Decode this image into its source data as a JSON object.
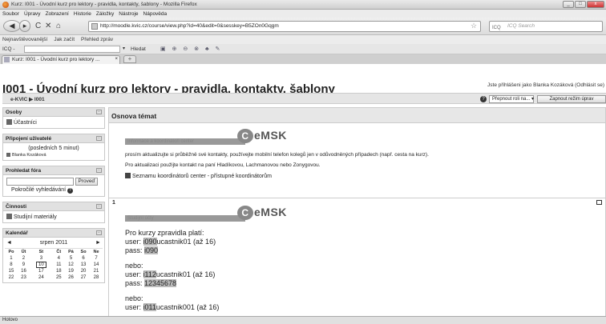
{
  "window": {
    "title": "Kurz: I001 - Úvodní kurz pro lektory - pravidla, kontakty, šablony - Mozilla Firefox",
    "btn_min": "_",
    "btn_max": "□",
    "btn_close": "x"
  },
  "menu": [
    "Soubor",
    "Úpravy",
    "Zobrazení",
    "Historie",
    "Záložky",
    "Nástroje",
    "Nápověda"
  ],
  "nav": {
    "url": "http://moodle.kvic.cz/course/view.php?id=40&edit=0&sesskey=B5ZOn0Gqgm",
    "search_placeholder": "ICQ Search",
    "search_engine": "ICQ"
  },
  "bookmarks": [
    "Nejnavštěvovanější",
    "Jak začít",
    "Přehled zpráv"
  ],
  "icq": {
    "label": "ICQ -",
    "find": "Hledat"
  },
  "tab": {
    "label": "Kurz: I001 - Úvodní kurz pro lektory ...",
    "close": "×",
    "new": "+"
  },
  "page": {
    "course_title": "I001 - Úvodní kurz pro lektory - pravidla, kontakty, šablony",
    "logged_in": "Jste přihlášeni jako Blanka Kozáková (Odhlásit se)",
    "breadcrumb": "e-KVIC ▶ I001",
    "help": "?",
    "role_select": "Přepnout roli na... ▾",
    "edit_button": "Zapnout režim úprav"
  },
  "sidebar": {
    "people": {
      "title": "Osoby",
      "item": "Účastníci"
    },
    "online": {
      "title": "Připojení uživatelé",
      "period": "(posledních 5 minut)",
      "user": "Blanka Kozáková"
    },
    "forum": {
      "title": "Prohledat fóra",
      "button": "Proveď",
      "advanced": "Pokročilé vyhledávání"
    },
    "activities": {
      "title": "Činnosti",
      "item": "Studijní materiály"
    },
    "calendar": {
      "title": "Kalendář",
      "prev": "◄",
      "next": "►",
      "month": "srpen 2011",
      "days": [
        "Po",
        "Út",
        "St",
        "Čt",
        "Pá",
        "So",
        "Ne"
      ],
      "weeks": [
        [
          "1",
          "2",
          "3",
          "4",
          "5",
          "6",
          "7"
        ],
        [
          "8",
          "9",
          "10",
          "11",
          "12",
          "13",
          "14"
        ],
        [
          "15",
          "16",
          "17",
          "18",
          "19",
          "20",
          "21"
        ],
        [
          "22",
          "23",
          "24",
          "25",
          "26",
          "27",
          "28"
        ]
      ],
      "today": "10"
    },
    "hide": "−"
  },
  "main": {
    "section_title": "Osnova témat",
    "logo_text": "eMSK",
    "logo_c": "C",
    "topic0": {
      "bar_text": "Informace a koordinátoři center",
      "p1": "prosím aktualizujte si průběžně své kontakty, používejte mobilní telefon kolegů jen v odůvodněných případech (např. cesta na kurz).",
      "p2": "Pro aktualizaci použijte kontakt na paní Hladíkovou, Lachmanovou nebo Zonygovou.",
      "link": "Seznamu koordinátorů center - přístupné koordinátorům"
    },
    "topic1": {
      "num": "1",
      "bar_text": "Studijní účty",
      "intro": "Pro kurzy zpravidla platí:",
      "user1_prefix": "user: ",
      "user1_hl": "i090",
      "user1_suffix": "ucastnik01 (až 16)",
      "pass1_prefix": "pass: ",
      "pass1_hl": "i090",
      "or1": "nebo:",
      "user2_prefix": "user: ",
      "user2_hl": "i112",
      "user2_suffix": "ucastnik01 (až 16)",
      "pass2_prefix": "pass: ",
      "pass2_hl": "12345678",
      "or2": "nebo:",
      "user3_prefix": "user: ",
      "user3_hl": "i011",
      "user3_suffix": "ucastnik001 (až 16)"
    }
  },
  "status": "Hotovo"
}
